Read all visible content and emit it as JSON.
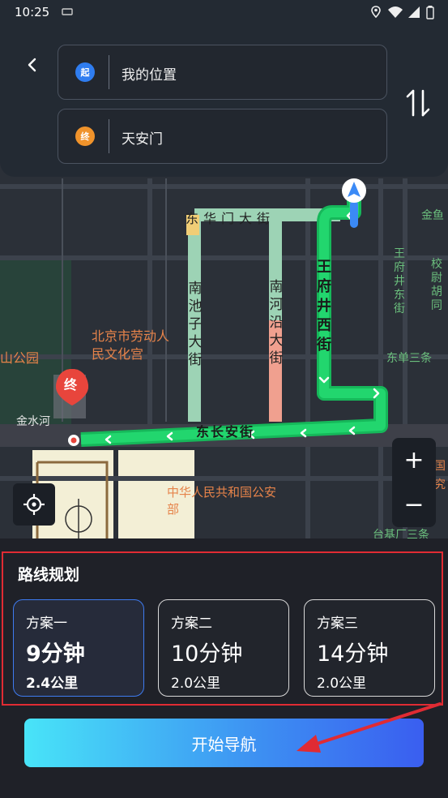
{
  "status_bar": {
    "time": "10:25",
    "icons": [
      "sim-card-icon",
      "location-icon",
      "wifi-icon",
      "signal-icon",
      "battery-icon"
    ]
  },
  "route": {
    "start": {
      "badge": "起",
      "label": "我的位置",
      "badge_color": "#2f7df0"
    },
    "end": {
      "badge": "终",
      "label": "天安门",
      "badge_color": "#f0932b"
    },
    "back_icon": "chevron-left-icon",
    "swap_icon": "swap-vertical-icon"
  },
  "map": {
    "labels": {
      "labor_palace": "北京市劳动人民文化宫",
      "park": "山公园",
      "jinshui": "金水河",
      "donghuamen": "东华门大街",
      "nanchizi": "南池子大街",
      "nanheyan": "南河沿大街",
      "wangfujing": "王府井西街",
      "wangfujing_east": "王府井东街",
      "jiaowei": "校尉胡同",
      "jinyu": "金鱼",
      "dongdan": "东单三条",
      "changan": "东长安街",
      "police": "中华人民共和国公安部",
      "taiji": "台基厂三条",
      "right_edge": "国",
      "right_edge2": "究"
    },
    "end_marker": "终",
    "colors": {
      "route_main": "#1fc96a",
      "traffic_slow": "#9dd3b5",
      "traffic_jam": "#f0a08f",
      "start_pin": "#3b8af6",
      "end_pin": "#e8453c"
    }
  },
  "controls": {
    "locate_icon": "crosshair-icon",
    "zoom_in": "+",
    "zoom_out": "−"
  },
  "plans": {
    "title": "路线规划",
    "items": [
      {
        "name": "方案一",
        "time": "9分钟",
        "distance": "2.4公里",
        "selected": true
      },
      {
        "name": "方案二",
        "time": "10分钟",
        "distance": "2.0公里",
        "selected": false
      },
      {
        "name": "方案三",
        "time": "14分钟",
        "distance": "2.0公里",
        "selected": false
      }
    ]
  },
  "start_navigation": "开始导航",
  "annotation": {
    "highlight_color": "#e02b33"
  }
}
